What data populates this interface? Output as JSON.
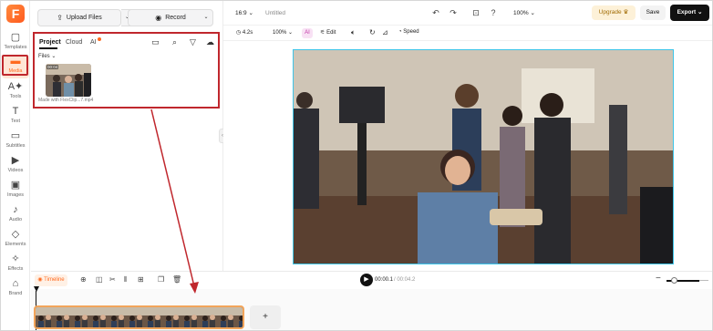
{
  "app": {
    "logo_letter": "F"
  },
  "rail": {
    "items": [
      {
        "label": "Templates",
        "icon": "templates-icon"
      },
      {
        "label": "Media",
        "icon": "media-icon",
        "active": true
      },
      {
        "label": "Tools",
        "icon": "ai-tools-icon"
      },
      {
        "label": "Text",
        "icon": "text-icon"
      },
      {
        "label": "Subtitles",
        "icon": "subtitles-icon"
      },
      {
        "label": "Videos",
        "icon": "videos-icon"
      },
      {
        "label": "Images",
        "icon": "images-icon"
      },
      {
        "label": "Audio",
        "icon": "audio-icon"
      },
      {
        "label": "Elements",
        "icon": "elements-icon"
      },
      {
        "label": "Effects",
        "icon": "effects-icon"
      },
      {
        "label": "Brand",
        "icon": "brand-icon"
      }
    ]
  },
  "panel": {
    "upload_label": "Upload Files",
    "record_label": "Record",
    "tabs": [
      "Project",
      "Cloud",
      "AI"
    ],
    "files_label": "Files",
    "thumb_duration": "00:04",
    "file_name": "Made with FlexClip...7.mp4"
  },
  "topbar": {
    "aspect": "16:9",
    "title": "Untitled",
    "zoom": "100%",
    "upgrade": "Upgrade",
    "save": "Save",
    "export": "Export"
  },
  "toolbar": {
    "duration": "4.2s",
    "scale": "100%",
    "ai": "AI",
    "edit": "Edit",
    "speed": "Speed"
  },
  "timeline": {
    "label": "Timeline",
    "current_time": "00:00.1",
    "total_time": "/ 00:04.2",
    "add": "+"
  },
  "colors": {
    "accent": "#ff6a1f",
    "highlight": "#c0272d",
    "canvas_border": "#3ec5e8",
    "export_bg": "#111111"
  }
}
